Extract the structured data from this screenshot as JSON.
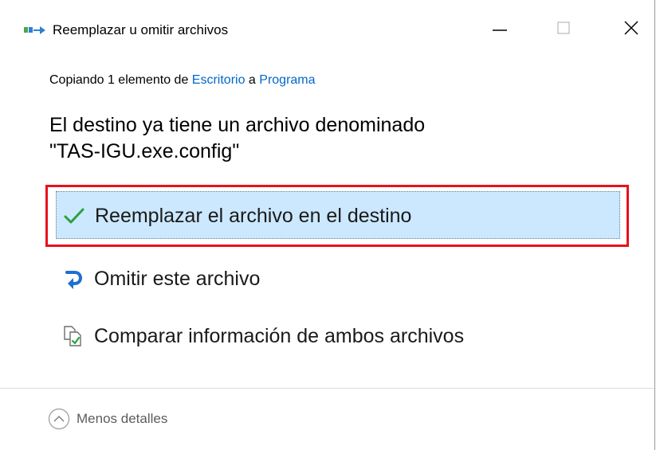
{
  "window": {
    "title": "Reemplazar u omitir archivos",
    "app_icon": "file-move-icon",
    "controls": {
      "minimize_icon": "minimize-icon",
      "maximize_icon": "maximize-icon",
      "close_icon": "close-icon"
    }
  },
  "copy_info": {
    "prefix": "Copiando 1 elemento de ",
    "source": "Escritorio",
    "connector": " a ",
    "destination": "Programa"
  },
  "message": {
    "line1": "El destino ya tiene un archivo denominado",
    "line2": "\"TAS-IGU.exe.config\""
  },
  "options": [
    {
      "label": "Reemplazar el archivo en el destino",
      "icon": "checkmark-icon",
      "selected": true
    },
    {
      "label": "Omitir este archivo",
      "icon": "skip-arrow-icon",
      "selected": false
    },
    {
      "label": "Comparar información de ambos archivos",
      "icon": "compare-files-icon",
      "selected": false
    }
  ],
  "footer": {
    "details_label": "Menos detalles",
    "details_icon": "chevron-up-icon"
  },
  "colors": {
    "link": "#0066cc",
    "selected_bg": "#cce8ff",
    "highlight_border": "#e8111b",
    "check_green": "#2aa13f",
    "skip_blue": "#1e6fd0"
  }
}
